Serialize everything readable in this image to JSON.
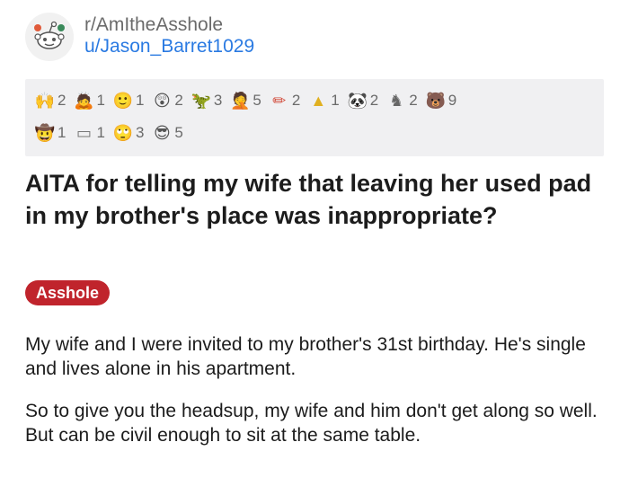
{
  "post": {
    "subreddit": "r/AmItheAsshole",
    "username": "u/Jason_Barret1029",
    "title": "AITA for telling my wife that leaving her used pad in my brother's place was inappropriate?",
    "flair": "Asshole",
    "flair_color": "#c0242c",
    "link_color": "#2a7ae2",
    "body": [
      "My wife and I were invited to my brother's 31st birthday. He's single and lives alone in his apartment.",
      "So to give you the headsup, my wife and him don't get along so well. But can be civil enough to sit at the same table."
    ]
  },
  "awards": {
    "row1": [
      {
        "icon": "hands-award-icon",
        "count": "2"
      },
      {
        "icon": "bowing-award-icon",
        "count": "1"
      },
      {
        "icon": "wholesome-face-award-icon",
        "count": "1"
      },
      {
        "icon": "shocked-face-award-icon",
        "count": "2"
      },
      {
        "icon": "dino-award-icon",
        "count": "3"
      },
      {
        "icon": "face-palm-award-icon",
        "count": "5"
      },
      {
        "icon": "pencil-award-icon",
        "count": "2"
      },
      {
        "icon": "gold-award-icon",
        "count": "1"
      },
      {
        "icon": "panda-award-icon",
        "count": "2"
      },
      {
        "icon": "knight-award-icon",
        "count": "2"
      },
      {
        "icon": "bear-award-icon",
        "count": "9"
      }
    ],
    "row2": [
      {
        "icon": "cowboy-award-icon",
        "count": "1"
      },
      {
        "icon": "box-award-icon",
        "count": "1"
      },
      {
        "icon": "eye-roll-award-icon",
        "count": "3"
      },
      {
        "icon": "shades-award-icon",
        "count": "5"
      }
    ]
  }
}
